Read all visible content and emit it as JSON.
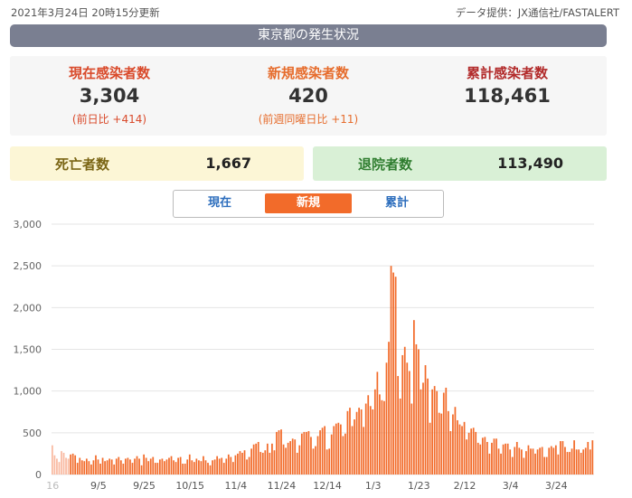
{
  "header": {
    "updated": "2021年3月24日 20時15分更新",
    "source": "データ提供：JX通信社/FASTALERT"
  },
  "title": "東京都の発生状況",
  "stats": {
    "current": {
      "label": "現在感染者数",
      "value": "3,304",
      "diff": "(前日比 +414)"
    },
    "new": {
      "label": "新規感染者数",
      "value": "420",
      "diff": "(前週同曜日比 +11)"
    },
    "total": {
      "label": "累計感染者数",
      "value": "118,461"
    }
  },
  "deaths": {
    "label": "死亡者数",
    "value": "1,667"
  },
  "recovered": {
    "label": "退院者数",
    "value": "113,490"
  },
  "tabs": [
    "現在",
    "新規",
    "累計"
  ],
  "active_tab": "新規",
  "colors": {
    "bar": "#f26b2a",
    "bar_light": "#f9b9a0",
    "title_bg": "#7a7f91",
    "tab_active": "#f26b2a",
    "tab_text": "#2d6ebd"
  },
  "chart_data": {
    "type": "bar",
    "ylim": [
      0,
      3000
    ],
    "yticks": [
      "0",
      "500",
      "1,000",
      "1,500",
      "2,000",
      "2,500",
      "3,000"
    ],
    "ytick_values": [
      0,
      500,
      1000,
      1500,
      2000,
      2500,
      3000
    ],
    "xtick_labels": [
      "16",
      "9/5",
      "9/25",
      "10/15",
      "11/4",
      "11/24",
      "12/14",
      "1/3",
      "1/23",
      "2/12",
      "3/4",
      "3/24"
    ],
    "xtick_indices": [
      0,
      20,
      40,
      60,
      80,
      100,
      120,
      140,
      160,
      180,
      200,
      220
    ],
    "grid": true,
    "values": [
      350,
      230,
      190,
      150,
      280,
      260,
      200,
      190,
      240,
      250,
      230,
      140,
      200,
      170,
      160,
      190,
      160,
      120,
      170,
      230,
      180,
      130,
      200,
      160,
      170,
      190,
      180,
      120,
      190,
      210,
      170,
      130,
      190,
      200,
      180,
      140,
      190,
      220,
      190,
      110,
      240,
      200,
      160,
      190,
      210,
      140,
      140,
      180,
      190,
      160,
      180,
      200,
      220,
      170,
      150,
      200,
      210,
      130,
      130,
      180,
      240,
      170,
      150,
      190,
      170,
      160,
      220,
      170,
      140,
      110,
      170,
      180,
      220,
      190,
      200,
      140,
      190,
      240,
      210,
      150,
      230,
      250,
      280,
      260,
      290,
      180,
      210,
      310,
      360,
      370,
      390,
      270,
      260,
      290,
      370,
      260,
      370,
      290,
      510,
      530,
      540,
      360,
      320,
      380,
      400,
      430,
      420,
      260,
      350,
      490,
      510,
      510,
      520,
      450,
      310,
      340,
      460,
      530,
      560,
      580,
      300,
      310,
      480,
      580,
      610,
      620,
      600,
      460,
      490,
      760,
      800,
      580,
      660,
      750,
      800,
      780,
      570,
      850,
      950,
      820,
      780,
      1020,
      1230,
      960,
      890,
      880,
      1340,
      1590,
      2500,
      2420,
      2370,
      1180,
      910,
      1430,
      1530,
      1340,
      1240,
      850,
      1850,
      1560,
      1500,
      1020,
      1100,
      1310,
      1150,
      620,
      1020,
      1060,
      1000,
      740,
      730,
      980,
      1040,
      760,
      520,
      720,
      810,
      650,
      600,
      580,
      630,
      420,
      500,
      550,
      560,
      510,
      380,
      360,
      440,
      450,
      390,
      250,
      380,
      430,
      430,
      310,
      250,
      360,
      370,
      370,
      300,
      210,
      330,
      390,
      320,
      300,
      200,
      280,
      350,
      310,
      310,
      250,
      300,
      320,
      330,
      210,
      210,
      320,
      340,
      320,
      350,
      240,
      400,
      400,
      330,
      270,
      270,
      310,
      410,
      300,
      300,
      260,
      300,
      320,
      390,
      300,
      410
    ]
  }
}
